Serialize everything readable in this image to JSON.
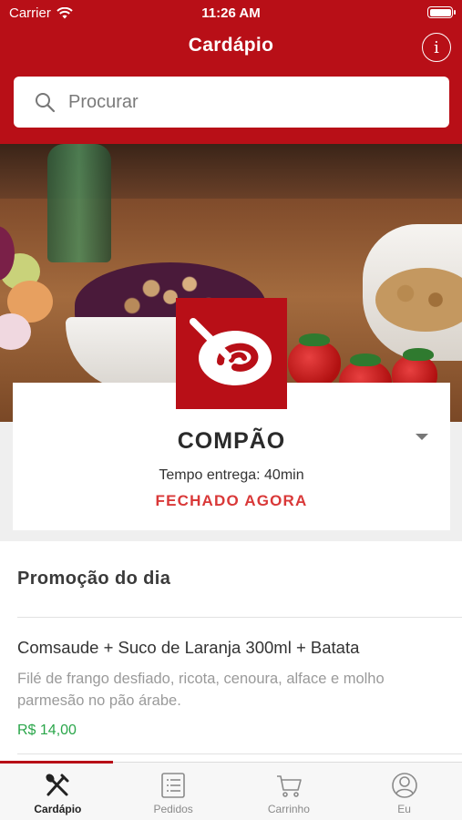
{
  "status_bar": {
    "carrier": "Carrier",
    "time": "11:26 AM"
  },
  "header": {
    "title": "Cardápio",
    "info_icon": "info-icon"
  },
  "search": {
    "placeholder": "Procurar"
  },
  "store": {
    "name": "COMPÃO",
    "delivery_time": "Tempo entrega: 40min",
    "status": "FECHADO AGORA"
  },
  "menu": {
    "section_title": "Promoção do dia",
    "items": [
      {
        "name": "Comsaude + Suco de Laranja 300ml + Batata",
        "description": "Filé de frango desfiado, ricota, cenoura, alface e molho parmesão no pão árabe.",
        "price": "R$ 14,00"
      }
    ]
  },
  "tabs": [
    {
      "label": "Cardápio",
      "icon": "fork-knife-icon",
      "active": true
    },
    {
      "label": "Pedidos",
      "icon": "list-icon",
      "active": false
    },
    {
      "label": "Carrinho",
      "icon": "cart-icon",
      "active": false
    },
    {
      "label": "Eu",
      "icon": "user-icon",
      "active": false
    }
  ],
  "colors": {
    "brand": "#b80f17",
    "closed": "#d93838",
    "price": "#2aa64a"
  }
}
